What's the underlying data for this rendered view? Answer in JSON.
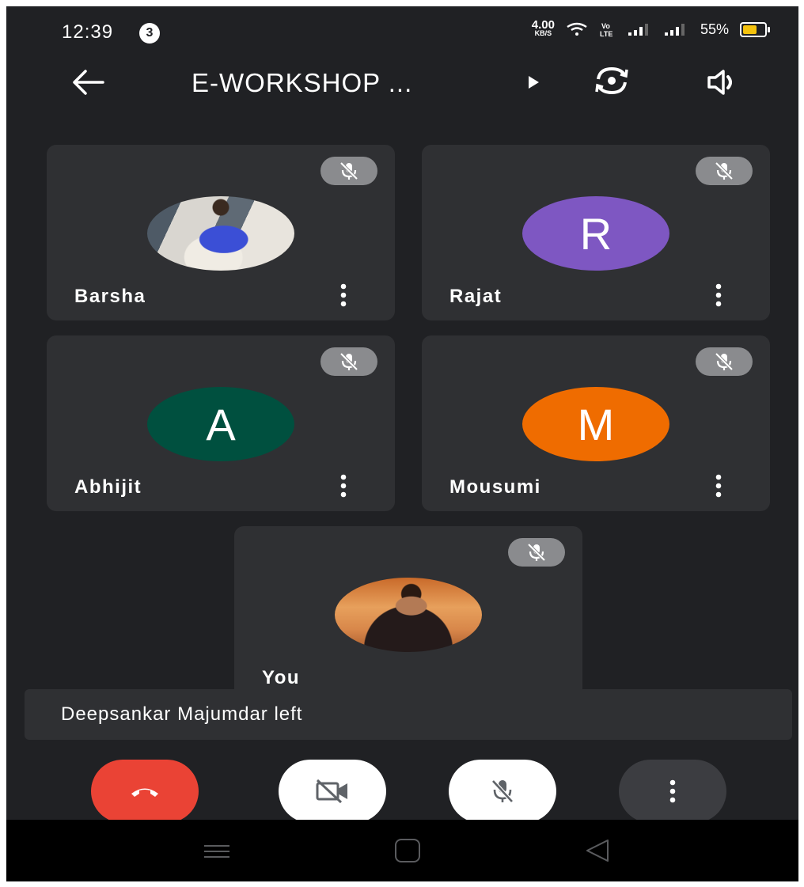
{
  "status_bar": {
    "time": "12:39",
    "notification_count": "3",
    "net_speed_value": "4.00",
    "net_speed_unit": "KB/S",
    "volte": "Vo\nLTE",
    "battery": "55%",
    "battery_color": "#f4c20d"
  },
  "header": {
    "title": "E-WORKSHOP ...",
    "back_icon": "arrow-left-icon",
    "switch_camera_icon": "switch-camera-icon",
    "speaker_icon": "speaker-icon"
  },
  "participants": [
    {
      "name": "Barsha",
      "avatar_type": "photo",
      "mic": "muted"
    },
    {
      "name": "Rajat",
      "avatar_type": "initial",
      "initial": "R",
      "color": "#7e57c2",
      "mic": "muted"
    },
    {
      "name": "Abhijit",
      "avatar_type": "initial",
      "initial": "A",
      "color": "#00503f",
      "mic": "muted"
    },
    {
      "name": "Mousumi",
      "avatar_type": "initial",
      "initial": "M",
      "color": "#ef6c00",
      "mic": "muted"
    },
    {
      "name": "You",
      "avatar_type": "photo",
      "mic": "muted"
    }
  ],
  "toast": {
    "text": "Deepsankar Majumdar left"
  },
  "controls": {
    "end_call_color": "#ea4335",
    "end_call_icon": "phone-hangup-icon",
    "camera_icon": "camera-off-icon",
    "mic_icon": "mic-off-icon",
    "more_icon": "more-vertical-icon"
  }
}
